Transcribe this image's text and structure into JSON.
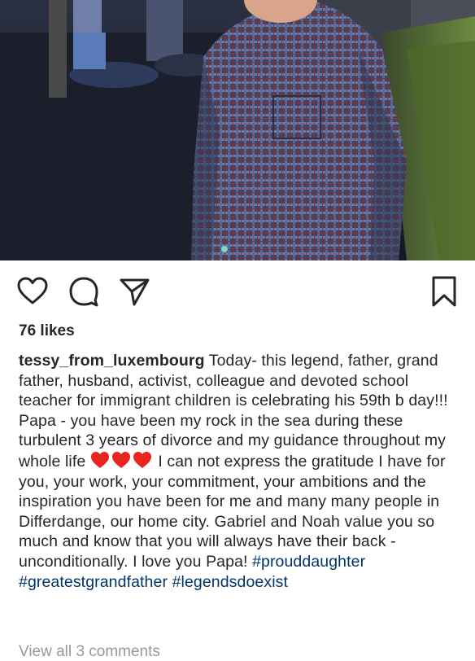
{
  "post": {
    "likes": "76 likes",
    "username": "tessy_from_luxembourg",
    "caption_part1": " Today- this legend, father, grand father, husband, activist, colleague and devoted school teacher for immigrant children is celebrating his 59th b day!!! Papa - you have been my rock in the sea during these turbulent 3 years of divorce and my guidance throughout my whole life ",
    "heart_count": 3,
    "heart_color": "#e8251f",
    "caption_part2": " I can not express the gratitude I have for you, your work, your commitment, your ambitions and the inspiration you have been for me and many many people in Differdange, our home city. Gabriel and Noah value you so much and know that you will always have their back - unconditionally.  I love you Papa! ",
    "hashtags": [
      "#prouddaughter",
      "#greatestgrandfather",
      "#legendsdoexist"
    ],
    "view_comments": "View all 3 comments"
  },
  "actions": {
    "icons": [
      "heart-outline-icon",
      "comment-bubble-icon",
      "paper-plane-icon",
      "bookmark-outline-icon"
    ]
  },
  "colors": {
    "text": "#262626",
    "hashtag": "#003569",
    "muted": "#999999"
  }
}
